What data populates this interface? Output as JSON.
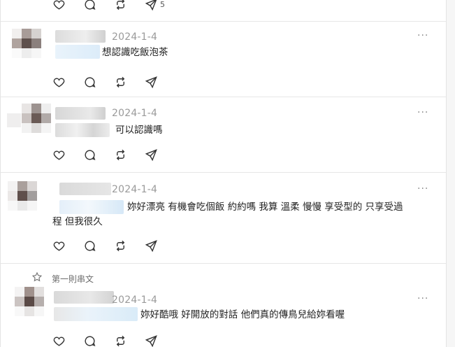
{
  "top_actions": {
    "share_count": "5"
  },
  "thread_label": "第一則串文",
  "more_label": "···",
  "posts": [
    {
      "date": "2024-1-4",
      "text": "想認識吃飯泡茶"
    },
    {
      "date": "2024-1-4",
      "text": "可以認識嗎"
    },
    {
      "date": "2024-1-4",
      "text": "妳好漂亮 有機會吃個飯 約約嗎 我算 溫柔 慢慢 享受型的 只享受過",
      "text2": "程 但我很久"
    },
    {
      "date": "2024-1-4",
      "text": "妳好酷哦 好開放的對話 他們真的傳鳥兒給妳看喔"
    }
  ]
}
